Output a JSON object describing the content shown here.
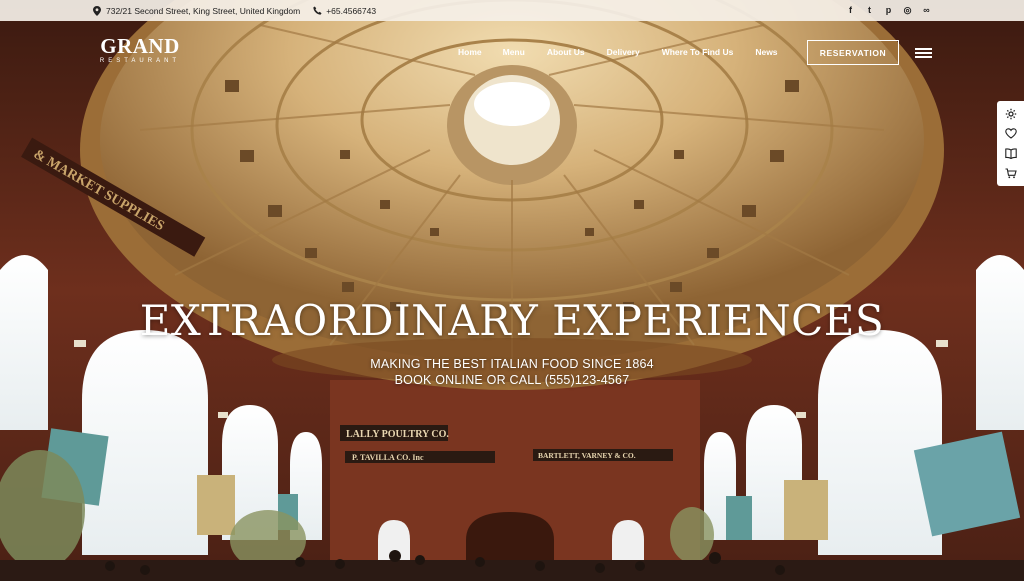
{
  "topbar": {
    "address": "732/21 Second Street, King Street, United Kingdom",
    "phone": "+65.4566743",
    "socials": [
      {
        "name": "facebook-icon",
        "glyph": "f"
      },
      {
        "name": "twitter-icon",
        "glyph": "t"
      },
      {
        "name": "pinterest-icon",
        "glyph": "p"
      },
      {
        "name": "instagram-icon",
        "glyph": "◎"
      },
      {
        "name": "tripadvisor-icon",
        "glyph": "∞"
      }
    ]
  },
  "logo": {
    "main": "GRAND",
    "sub": "RESTAURANT"
  },
  "nav": {
    "items": [
      "Home",
      "Menu",
      "About Us",
      "Delivery",
      "Where To Find Us",
      "News"
    ]
  },
  "header": {
    "reservation_label": "RESERVATION"
  },
  "hero": {
    "title": "EXTRAORDINARY EXPERIENCES",
    "line1": "MAKING THE BEST ITALIAN FOOD SINCE 1864",
    "line2": "BOOK ONLINE OR CALL (555)123-4567"
  },
  "scene": {
    "signs": [
      "LALLY POULTRY CO.",
      "P. TAVILLA CO. Inc",
      "BARTLETT, VARNEY & CO.",
      "& MARKET SUPPLIES"
    ]
  },
  "colors": {
    "brick": "#6b2e1c",
    "dome": "#c9a46a",
    "topbar_bg": "#f5f0e8"
  }
}
